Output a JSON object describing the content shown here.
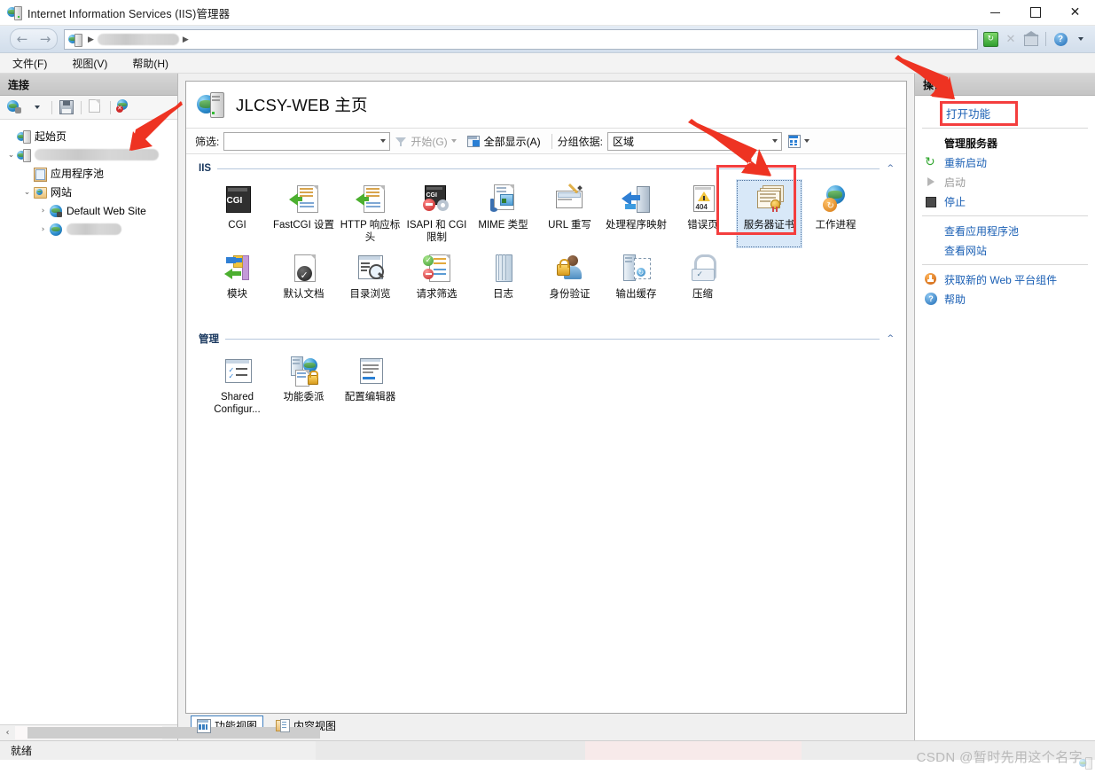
{
  "window": {
    "title": "Internet Information Services (IIS)管理器",
    "icon": "iis-server-icon",
    "minimize": "—",
    "maximize": "□",
    "close": "✕"
  },
  "address_bar": {
    "back": "←",
    "forward": "→",
    "root_icon": "iis-server-icon",
    "crumb_sep": "▶",
    "redacted_server": "",
    "tools": [
      "refresh-icon",
      "stop-icon",
      "home-icon",
      "help-icon"
    ]
  },
  "menubar": {
    "items": [
      {
        "label": "文件(F)",
        "name": "menu-file"
      },
      {
        "label": "视图(V)",
        "name": "menu-view"
      },
      {
        "label": "帮助(H)",
        "name": "menu-help"
      }
    ]
  },
  "connections": {
    "header": "连接",
    "toolbar": [
      "connect-icon",
      "save-icon",
      "edit-icon",
      "disconnect-icon"
    ],
    "tree": [
      {
        "label": "起始页",
        "icon": "start-page-icon",
        "indent": 1,
        "chevron": ""
      },
      {
        "label": "",
        "icon": "server-icon",
        "indent": 1,
        "chevron": "v",
        "redacted": true
      },
      {
        "label": "应用程序池",
        "icon": "app-pool-icon",
        "indent": 2,
        "chevron": ""
      },
      {
        "label": "网站",
        "icon": "sites-folder-icon",
        "indent": 2,
        "chevron": "v"
      },
      {
        "label": "Default Web Site",
        "icon": "website-icon",
        "indent": 3,
        "chevron": ">"
      },
      {
        "label": "",
        "icon": "website-icon",
        "indent": 3,
        "chevron": ">",
        "redacted": true
      }
    ]
  },
  "page": {
    "icon": "iis-server-icon",
    "title": "JLCSY-WEB 主页"
  },
  "filter_bar": {
    "filter_label": "筛选:",
    "filter_value": "",
    "go_label": "开始(G)",
    "show_all_label": "全部显示(A)",
    "group_by_label": "分组依据:",
    "group_by_value": "区域"
  },
  "feature_groups": [
    {
      "title": "IIS",
      "collapse": "^",
      "items": [
        {
          "label": "CGI",
          "icon": "cgi-icon",
          "selected": false
        },
        {
          "label": "FastCGI 设置",
          "icon": "fastcgi-settings-icon",
          "selected": false
        },
        {
          "label": "HTTP 响应标头",
          "icon": "http-response-headers-icon",
          "selected": false
        },
        {
          "label": "ISAPI 和 CGI 限制",
          "icon": "isapi-cgi-restrictions-icon",
          "selected": false
        },
        {
          "label": "MIME 类型",
          "icon": "mime-types-icon",
          "selected": false
        },
        {
          "label": "URL 重写",
          "icon": "url-rewrite-icon",
          "selected": false
        },
        {
          "label": "处理程序映射",
          "icon": "handler-mappings-icon",
          "selected": false
        },
        {
          "label": "错误页",
          "icon": "error-pages-icon",
          "selected": false
        },
        {
          "label": "服务器证书",
          "icon": "server-certificates-icon",
          "selected": true
        },
        {
          "label": "工作进程",
          "icon": "worker-processes-icon",
          "selected": false
        },
        {
          "label": "模块",
          "icon": "modules-icon",
          "selected": false
        },
        {
          "label": "默认文档",
          "icon": "default-document-icon",
          "selected": false
        },
        {
          "label": "目录浏览",
          "icon": "directory-browsing-icon",
          "selected": false
        },
        {
          "label": "请求筛选",
          "icon": "request-filtering-icon",
          "selected": false
        },
        {
          "label": "日志",
          "icon": "logging-icon",
          "selected": false
        },
        {
          "label": "身份验证",
          "icon": "authentication-icon",
          "selected": false
        },
        {
          "label": "输出缓存",
          "icon": "output-caching-icon",
          "selected": false
        },
        {
          "label": "压缩",
          "icon": "compression-icon",
          "selected": false
        }
      ]
    },
    {
      "title": "管理",
      "collapse": "^",
      "items": [
        {
          "label": "Shared Configur...",
          "icon": "shared-configuration-icon",
          "selected": false
        },
        {
          "label": "功能委派",
          "icon": "feature-delegation-icon",
          "selected": false
        },
        {
          "label": "配置编辑器",
          "icon": "configuration-editor-icon",
          "selected": false
        }
      ]
    }
  ],
  "view_tabs": [
    {
      "label": "功能视图",
      "icon": "features-view-icon",
      "active": true
    },
    {
      "label": "内容视图",
      "icon": "content-view-icon",
      "active": false
    }
  ],
  "actions": {
    "header": "操作",
    "open_feature": "打开功能",
    "items": [
      {
        "label": "管理服务器",
        "kind": "heading",
        "icon": ""
      },
      {
        "label": "重新启动",
        "kind": "link",
        "icon": "restart-icon"
      },
      {
        "label": "启动",
        "kind": "disabled",
        "icon": "play-icon"
      },
      {
        "label": "停止",
        "kind": "link",
        "icon": "stop-square-icon"
      },
      {
        "label": "查看应用程序池",
        "kind": "link-divider-before",
        "icon": ""
      },
      {
        "label": "查看网站",
        "kind": "link",
        "icon": ""
      },
      {
        "label": "获取新的 Web 平台组件",
        "kind": "link-divider-before",
        "icon": "web-pi-icon"
      },
      {
        "label": "帮助",
        "kind": "link",
        "icon": "help-icon"
      }
    ]
  },
  "statusbar": {
    "text": "就绪"
  },
  "watermark": {
    "text": "CSDN @暂时先用这个名字"
  },
  "colors": {
    "link": "#1a5fb4",
    "group_title": "#17365d",
    "highlight_box": "#f43e3e",
    "selection": "#d8e8f8",
    "arrow": "#ee3322"
  }
}
